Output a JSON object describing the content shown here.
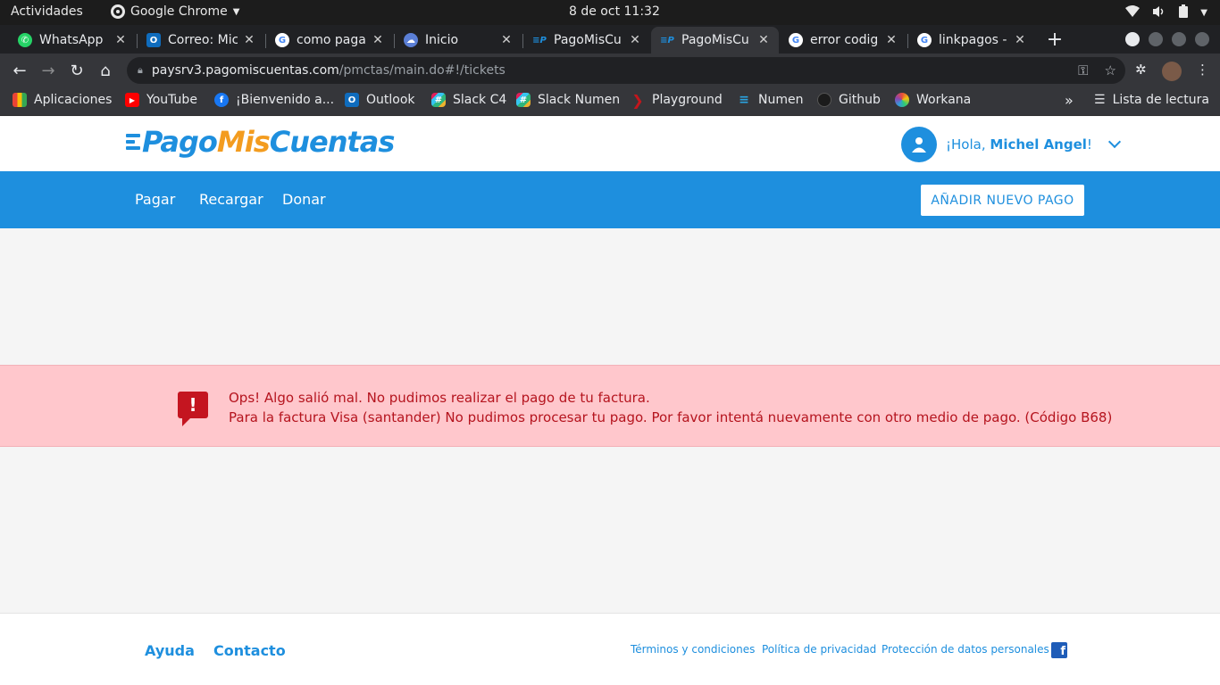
{
  "system_bar": {
    "activities": "Actividades",
    "app_name": "Google Chrome",
    "datetime": "8 de oct  11:32"
  },
  "tabs": [
    {
      "title": "WhatsApp",
      "icon": "whatsapp-icon",
      "color": "#25d366"
    },
    {
      "title": "Correo: Mic",
      "icon": "outlook-icon",
      "color": "#0f6cbd"
    },
    {
      "title": "como pagar",
      "icon": "google-icon",
      "color": "#4285f4"
    },
    {
      "title": "Inicio",
      "icon": "cloud-icon",
      "color": "#5b7fd6"
    },
    {
      "title": "PagoMisCu",
      "icon": "pagomiscuentas-icon",
      "color": "#1e8fde"
    },
    {
      "title": "PagoMisCu",
      "icon": "pagomiscuentas-icon",
      "color": "#1e8fde",
      "active": true
    },
    {
      "title": "error codig",
      "icon": "google-icon",
      "color": "#4285f4"
    },
    {
      "title": "linkpagos -",
      "icon": "google-icon",
      "color": "#4285f4"
    }
  ],
  "omnibox": {
    "host": "paysrv3.pagomiscuentas.com",
    "path": "/pmctas/main.do#!/tickets"
  },
  "bookmarks": [
    {
      "label": "Aplicaciones",
      "icon": "apps-grid-icon",
      "color": "#ea4335"
    },
    {
      "label": "YouTube",
      "icon": "youtube-icon",
      "color": "#ff0000"
    },
    {
      "label": "¡Bienvenido a...",
      "icon": "facebook-icon",
      "color": "#1877f2"
    },
    {
      "label": "Outlook",
      "icon": "outlook-icon",
      "color": "#0f6cbd"
    },
    {
      "label": "Slack C4",
      "icon": "slack-icon",
      "color": "#e01e5a"
    },
    {
      "label": "Slack Numen",
      "icon": "slack-icon",
      "color": "#e01e5a"
    },
    {
      "label": "Playground",
      "icon": "playground-icon",
      "color": "#c4161c"
    },
    {
      "label": "Numen",
      "icon": "numen-icon",
      "color": "#2aa3e0"
    },
    {
      "label": "Github",
      "icon": "github-icon",
      "color": "#333333"
    },
    {
      "label": "Workana",
      "icon": "workana-icon",
      "color": "#8e44ad"
    }
  ],
  "reading_list": "Lista de lectura",
  "site": {
    "logo": {
      "part1": "Pago",
      "part2": "Mis",
      "part3": "Cuentas"
    },
    "greeting": "¡Hola,",
    "user_name": "Michel Angel",
    "greeting_end": "!",
    "nav": [
      "Pagar",
      "Recargar",
      "Donar"
    ],
    "add_payment": "AÑADIR NUEVO PAGO",
    "brand_color": "#1e8fde",
    "accent_color": "#f39c1f"
  },
  "alert": {
    "line1": "Ops! Algo salió mal. No pudimos realizar el pago de tu factura.",
    "line2": "Para la factura Visa (santander) No pudimos procesar tu pago. Por favor intentá nuevamente con otro medio de pago. (Código B68)",
    "color": "#ffc7cc"
  },
  "footer": {
    "help": "Ayuda",
    "contact": "Contacto",
    "terms": "Términos y condiciones",
    "privacy": "Política de privacidad",
    "data_protection": "Protección de datos personales"
  }
}
